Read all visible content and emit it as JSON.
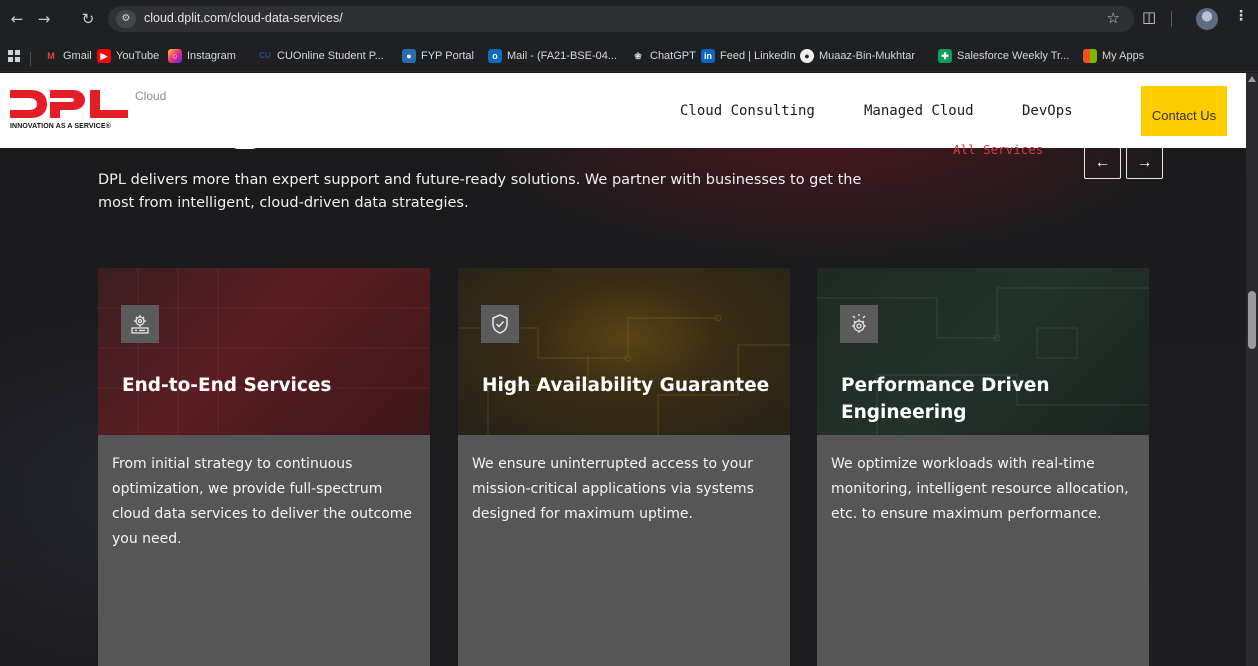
{
  "browser": {
    "url": "cloud.dplit.com/cloud-data-services/",
    "bookmarks": [
      {
        "label": "Gmail",
        "icon": "gmail-icon",
        "color": "#ea4335"
      },
      {
        "label": "YouTube",
        "icon": "youtube-icon",
        "color": "#ff0000"
      },
      {
        "label": "Instagram",
        "icon": "instagram-icon",
        "color": "#d62976"
      },
      {
        "label": "CUOnline Student P...",
        "icon": "cuonline-icon",
        "color": "#1b3a6b"
      },
      {
        "label": "FYP Portal",
        "icon": "fyp-portal-icon",
        "color": "#2b6cb0"
      },
      {
        "label": "Mail - (FA21-BSE-04...",
        "icon": "outlook-icon",
        "color": "#0f6cbd"
      },
      {
        "label": "ChatGPT",
        "icon": "chatgpt-icon",
        "color": "#6b6b6b"
      },
      {
        "label": "Feed | LinkedIn",
        "icon": "linkedin-icon",
        "color": "#0a66c2"
      },
      {
        "label": "Muaaz-Bin-Mukhtar",
        "icon": "github-icon",
        "color": "#24292f"
      },
      {
        "label": "Salesforce Weekly Tr...",
        "icon": "sheets-icon",
        "color": "#0f9d58"
      },
      {
        "label": "My Apps",
        "icon": "my-apps-icon",
        "color": "#f25022"
      }
    ]
  },
  "header": {
    "logo_text": "DPL",
    "logo_suffix": "Cloud",
    "tagline": "INNOVATION AS A SERVICE®",
    "nav": [
      "Cloud Consulting",
      "Managed Cloud",
      "DevOps"
    ],
    "contact_label": "Contact Us",
    "all_services": "All Services",
    "brand_red": "#e41e26",
    "accent_yellow": "#ffcc00"
  },
  "section": {
    "intro": "DPL delivers more than expert support and future-ready solutions. We partner with businesses to get the most from intelligent, cloud-driven data strategies.",
    "prev_label": "←",
    "next_label": "→"
  },
  "cards": [
    {
      "icon": "gear-server-icon",
      "title": "End-to-End Services",
      "text": "From initial strategy to continuous optimization, we provide full-spectrum cloud data services to deliver the outcome you need."
    },
    {
      "icon": "shield-check-icon",
      "title": "High Availability Guarantee",
      "text": "We ensure uninterrupted access to your mission-critical applications via systems designed for maximum uptime."
    },
    {
      "icon": "gear-performance-icon",
      "title": "Performance Driven Engineering",
      "text": "We optimize workloads with real-time monitoring, intelligent resource allocation, etc. to ensure maximum performance."
    }
  ]
}
